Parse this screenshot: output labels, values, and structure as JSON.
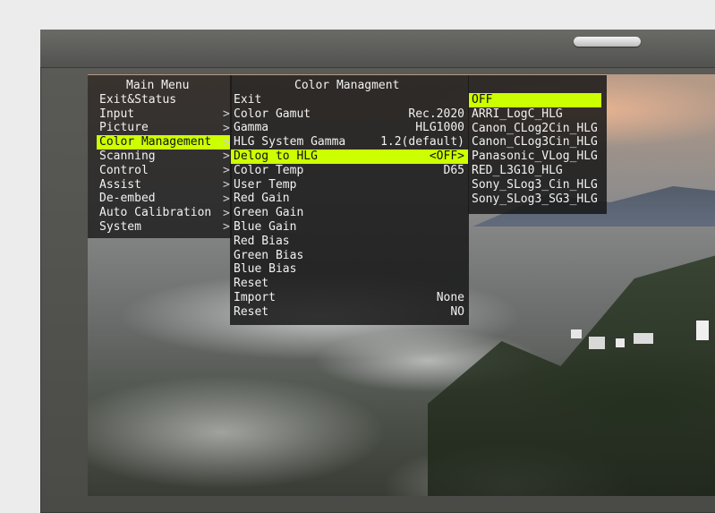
{
  "main_menu": {
    "title": "Main Menu",
    "items": [
      {
        "label": "Exit&Status"
      },
      {
        "label": " Input"
      },
      {
        "label": " Picture"
      },
      {
        "label": "Color Management"
      },
      {
        "label": " Scanning"
      },
      {
        "label": " Control"
      },
      {
        "label": " Assist"
      },
      {
        "label": " De-embed"
      },
      {
        "label": " Auto Calibration"
      },
      {
        "label": " System"
      }
    ],
    "selected_index": 3,
    "arrows": [
      ">",
      ">",
      ">",
      ">",
      ">",
      ">",
      ">",
      ">",
      ">"
    ]
  },
  "color_management": {
    "title": "Color Managment",
    "items": [
      {
        "label": "Exit",
        "value": ""
      },
      {
        "label": "Color Gamut",
        "value": "Rec.2020"
      },
      {
        "label": "Gamma",
        "value": "HLG1000"
      },
      {
        "label": "HLG System Gamma",
        "value": "1.2(default)"
      },
      {
        "label": "Delog to HLG",
        "value": "<OFF>"
      },
      {
        "label": "Color Temp",
        "value": "D65"
      },
      {
        "label": "User Temp",
        "value": ""
      },
      {
        "label": "Red Gain",
        "value": ""
      },
      {
        "label": "Green Gain",
        "value": ""
      },
      {
        "label": "Blue Gain",
        "value": ""
      },
      {
        "label": "Red Bias",
        "value": ""
      },
      {
        "label": "Green Bias",
        "value": ""
      },
      {
        "label": "Blue Bias",
        "value": ""
      },
      {
        "label": "Reset",
        "value": ""
      },
      {
        "label": "Import",
        "value": "None"
      },
      {
        "label": "Reset",
        "value": "NO"
      }
    ],
    "selected_index": 4
  },
  "delog_options": {
    "items": [
      {
        "label": "OFF"
      },
      {
        "label": "ARRI_LogC_HLG"
      },
      {
        "label": "Canon_CLog2Cin_HLG"
      },
      {
        "label": "Canon_CLog3Cin_HLG"
      },
      {
        "label": "Panasonic_VLog_HLG"
      },
      {
        "label": "RED_L3G10_HLG"
      },
      {
        "label": "Sony_SLog3_Cin_HLG"
      },
      {
        "label": "Sony_SLog3_SG3_HLG"
      }
    ],
    "selected_index": 0
  },
  "colors": {
    "highlight": "#ccff00",
    "bezel": "#55554f",
    "osd_text": "#f2f2f2"
  },
  "icons": {
    "power_indicator": "power-led-icon"
  }
}
